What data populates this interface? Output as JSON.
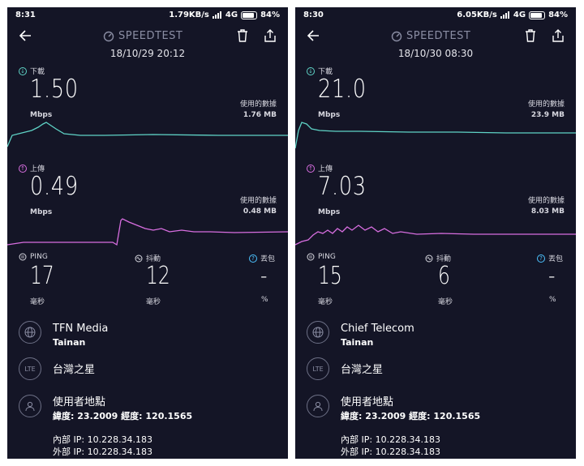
{
  "brand": "SPEEDTEST",
  "labels": {
    "download": "下載",
    "upload": "上傳",
    "unit_speed": "Mbps",
    "data_used": "使用的數據",
    "ping": "PING",
    "jitter": "抖動",
    "loss": "丟包",
    "ms": "毫秒",
    "percent": "%",
    "lte": "LTE",
    "carrier": "台灣之星",
    "location_title": "使用者地點"
  },
  "icons": [
    "back-arrow-icon",
    "speedtest-logo-icon",
    "trash-icon",
    "share-icon",
    "download-arrow-icon",
    "upload-arrow-icon",
    "ping-icon",
    "jitter-icon",
    "packet-loss-icon",
    "globe-icon",
    "lte-icon",
    "user-icon"
  ],
  "colors": {
    "background": "#141526",
    "download": "#5fd3c6",
    "upload": "#d86ee0",
    "status_help": "#4cc3ff"
  },
  "screens": [
    {
      "status": {
        "time": "8:31",
        "net": "1.79KB/s",
        "signal": "4G",
        "battery": "84%"
      },
      "datetime": "18/10/29 20:12",
      "download": {
        "value": "1.50",
        "used": "1.76 MB"
      },
      "upload": {
        "value": "0.49",
        "used": "0.48 MB"
      },
      "ping": "17",
      "jitter": "12",
      "loss": "-",
      "isp": "TFN Media",
      "city": "Tainan",
      "coords": "緯度: 23.2009 經度: 120.1565",
      "internal_ip": "內部 IP: 10.228.34.183",
      "external_ip": "外部 IP: 10.228.34.183"
    },
    {
      "status": {
        "time": "8:30",
        "net": "6.05KB/s",
        "signal": "4G",
        "battery": "84%"
      },
      "datetime": "18/10/30 08:30",
      "download": {
        "value": "21.0",
        "used": "23.9 MB"
      },
      "upload": {
        "value": "7.03",
        "used": "8.03 MB"
      },
      "ping": "15",
      "jitter": "6",
      "loss": "-",
      "isp": "Chief Telecom",
      "city": "Tainan",
      "coords": "緯度: 23.2009 經度: 120.1565",
      "internal_ip": "內部 IP: 10.228.34.183",
      "external_ip": "外部 IP: 10.228.34.183"
    }
  ]
}
